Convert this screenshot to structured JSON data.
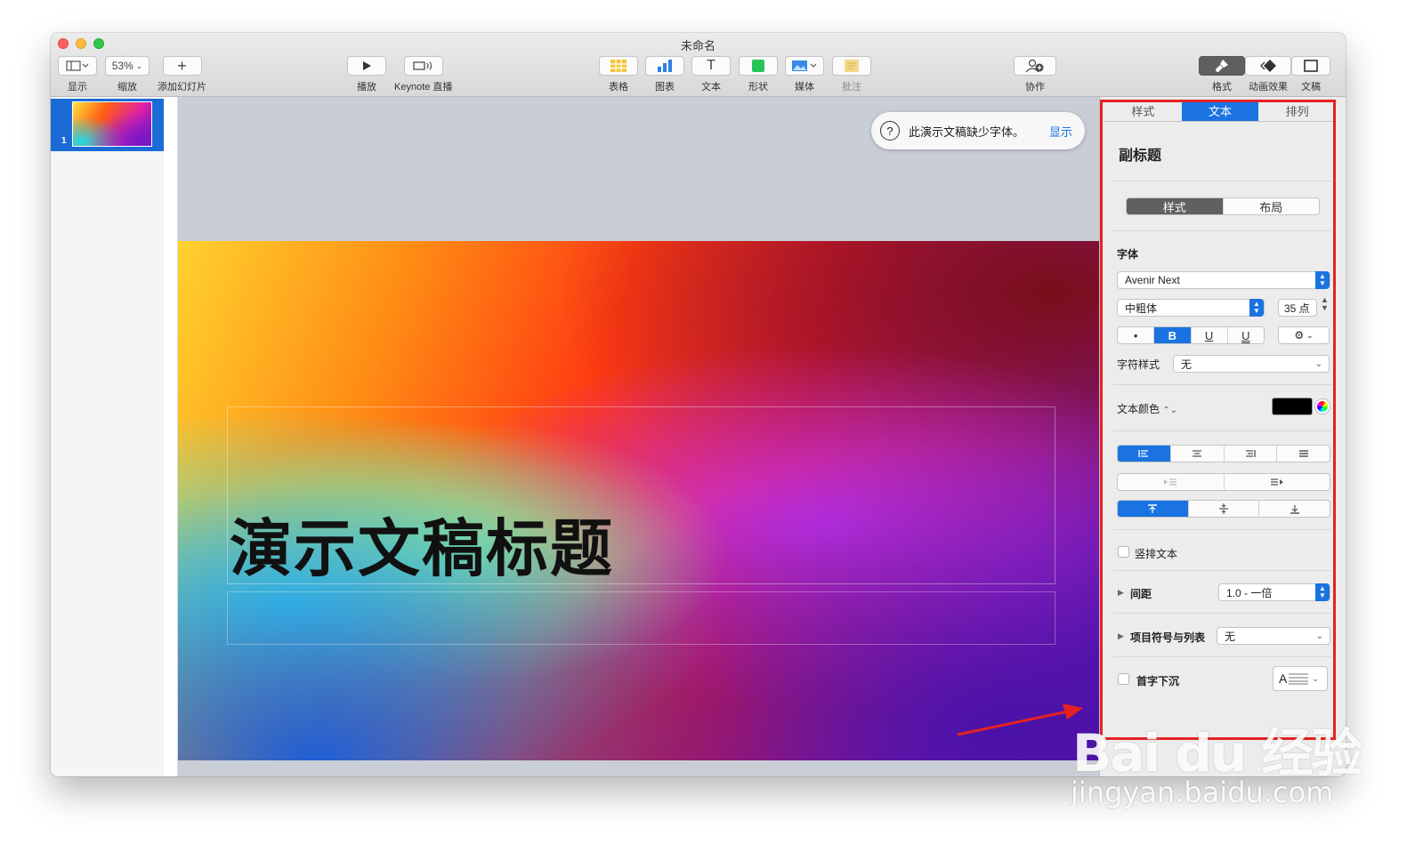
{
  "window": {
    "title": "未命名"
  },
  "toolbar": {
    "view": {
      "label": "显示",
      "icon": "sidebar-view-icon"
    },
    "zoom": {
      "label": "缩放",
      "value": "53%"
    },
    "add_slide": {
      "label": "添加幻灯片",
      "icon": "plus-icon"
    },
    "play": {
      "label": "播放",
      "icon": "play-icon"
    },
    "keynote_live": {
      "label": "Keynote 直播",
      "icon": "keynote-live-icon"
    },
    "table": {
      "label": "表格",
      "icon": "table-icon"
    },
    "chart": {
      "label": "图表",
      "icon": "chart-icon"
    },
    "text": {
      "label": "文本",
      "icon": "text-icon",
      "glyph": "T"
    },
    "shape": {
      "label": "形状",
      "icon": "shape-icon"
    },
    "media": {
      "label": "媒体",
      "icon": "media-icon"
    },
    "comment": {
      "label": "批注",
      "icon": "comment-icon"
    },
    "collaborate": {
      "label": "协作",
      "icon": "collaborate-icon"
    },
    "format": {
      "label": "格式",
      "icon": "format-brush-icon"
    },
    "animate": {
      "label": "动画效果",
      "icon": "animate-icon"
    },
    "document": {
      "label": "文稿",
      "icon": "document-icon"
    }
  },
  "navigator": {
    "slide_number": "1"
  },
  "notice": {
    "text": "此演示文稿缺少字体。",
    "action": "显示",
    "icon": "question-icon"
  },
  "slide": {
    "title": "演示文稿标题"
  },
  "inspector": {
    "tabs": [
      "样式",
      "文本",
      "排列"
    ],
    "section_title": "副标题",
    "subtabs": [
      "样式",
      "布局"
    ],
    "font_label": "字体",
    "font_family": "Avenir Next",
    "font_weight": "中粗体",
    "font_size": "35 点",
    "style_buttons": {
      "bullet": "•",
      "bold": "B",
      "underline": "U",
      "double_underline": "U",
      "gear": "⚙"
    },
    "char_style_label": "字符样式",
    "char_style_value": "无",
    "text_color_label": "文本颜色",
    "text_color_value": "#000000",
    "valign_icons": [
      "align-top-icon",
      "align-middle-icon",
      "align-bottom-icon"
    ],
    "vertical_text_label": "竖排文本",
    "spacing_label": "间距",
    "spacing_value": "1.0 - 一倍",
    "bullets_label": "项目符号与列表",
    "bullets_value": "无",
    "dropcap_label": "首字下沉",
    "dropcap_preview": "A"
  },
  "watermark": {
    "logo": "Bai du 经验",
    "url": "jingyan.baidu.com"
  },
  "colors": {
    "accent": "#1a73e0",
    "highlight": "#e52222"
  }
}
